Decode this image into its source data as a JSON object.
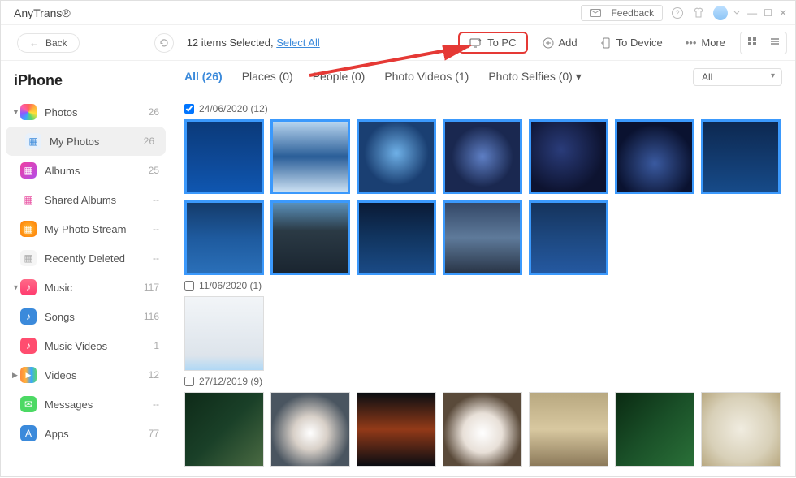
{
  "app_name": "AnyTrans®",
  "feedback_label": "Feedback",
  "back_label": "Back",
  "selection": {
    "prefix": "12 items Selected, ",
    "select_all": "Select All"
  },
  "toolbar": {
    "to_pc": "To PC",
    "add": "Add",
    "to_device": "To Device",
    "more": "More"
  },
  "device_name": "iPhone",
  "sidebar": {
    "photos": {
      "label": "Photos",
      "count": "26"
    },
    "sub_photos": [
      {
        "label": "My Photos",
        "count": "26",
        "active": true,
        "color": "#3b8adb",
        "bg": "#e8f1fb"
      },
      {
        "label": "Albums",
        "count": "25",
        "color": "#fff",
        "bg": "linear-gradient(135deg,#ef3fa1,#b44de8)"
      },
      {
        "label": "Shared Albums",
        "count": "--",
        "color": "#e84da0",
        "bg": "#fff"
      },
      {
        "label": "My Photo Stream",
        "count": "--",
        "bg": "radial-gradient(#ffbf3b,#ff7a00)"
      },
      {
        "label": "Recently Deleted",
        "count": "--",
        "color": "#aaa",
        "bg": "#f5f5f5"
      }
    ],
    "music": {
      "label": "Music",
      "count": "117"
    },
    "sub_music": [
      {
        "label": "Songs",
        "count": "116",
        "bg": "#3b8adb"
      },
      {
        "label": "Music Videos",
        "count": "1",
        "bg": "#ff4d6f"
      }
    ],
    "videos": {
      "label": "Videos",
      "count": "12"
    },
    "messages": {
      "label": "Messages",
      "count": "--"
    },
    "apps": {
      "label": "Apps",
      "count": "77"
    }
  },
  "tabs": [
    {
      "label": "All",
      "count": "(26)",
      "active": true
    },
    {
      "label": "Places",
      "count": "(0)"
    },
    {
      "label": "People",
      "count": "(0)"
    },
    {
      "label": "Photo Videos",
      "count": "(1)"
    },
    {
      "label": "Photo Selfies",
      "count": "(0)",
      "drop": true
    }
  ],
  "filter_value": "All",
  "groups": [
    {
      "date": "24/06/2020 (12)",
      "checked": true,
      "thumbs": [
        "linear-gradient(180deg,#0b3a7a 0%,#0e4a99 60%,#0f56b0 100%)",
        "linear-gradient(180deg,#b8d5ef 0%,#2a5e98 50%,#c9dff1 100%)",
        "radial-gradient(circle at 50% 45%,#6fb1e8 0%,#1a3f72 60%)",
        "radial-gradient(circle at 50% 50%,#5e7fc5 0%,#1a2850 60%)",
        "radial-gradient(circle at 40% 40%,#2a3c7a 0%,#0d1330 70%)",
        "radial-gradient(circle at 50% 60%,#3a5aa0 0%,#0a1230 70%)",
        "linear-gradient(180deg,#0d2850 0%,#164a88 100%)",
        "linear-gradient(180deg,#143b6b 0%,#1e5a9e 50%,#2a6fb8 100%)",
        "linear-gradient(180deg,#5a90ba 0%,#2b3a45 40%,#1a2530 100%)",
        "linear-gradient(180deg,#0a1a35 0%,#113560 50%,#1a4a85 100%)",
        "linear-gradient(180deg,#344868 0%,#5e7a9a 50%,#2a3648 100%)",
        "linear-gradient(180deg,#15335c 0%,#1d4880 50%,#2458a0 100%)"
      ]
    },
    {
      "date": "11/06/2020 (1)",
      "checked": false,
      "thumbs_unsel": [
        "linear-gradient(180deg,#f2f5f8 0%,#dde4eb 80%,#b0d8f5 100%)"
      ]
    },
    {
      "date": "27/12/2019 (9)",
      "checked": false,
      "thumbs_unsel": [
        "linear-gradient(135deg,#0e2a18 0%,#1a4028 50%,#4a6a42 100%)",
        "radial-gradient(circle at 50% 55%,#fff 0%,#d8d0c8 30%,#4a5560 70%)",
        "linear-gradient(180deg,#0a0d12 0%,#933a18 50%,#0a0d12 100%)",
        "radial-gradient(circle at 50% 55%,#fff 0%,#e8e0d8 35%,#5a4a3a 70%)",
        "linear-gradient(180deg,#b8a880 0%,#d8c8a0 50%,#8c7a5a 100%)",
        "linear-gradient(135deg,#0a2a12 0%,#1a5028 50%,#2a7038 100%)",
        "radial-gradient(circle at 50% 50%,#f0ece0 0%,#d8d0b8 60%,#b8a880 100%)"
      ]
    }
  ]
}
